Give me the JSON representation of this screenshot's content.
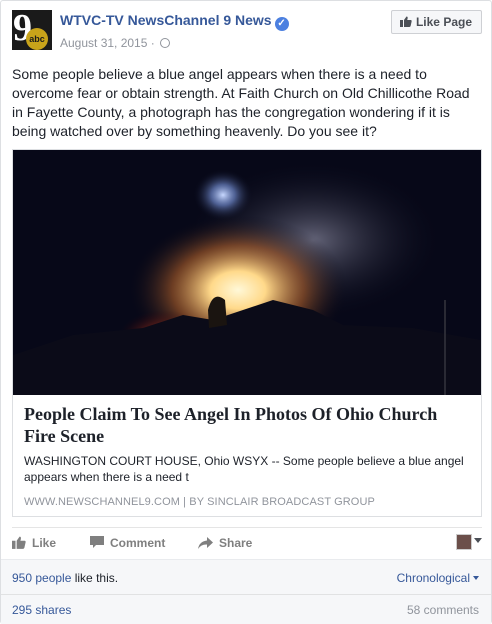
{
  "header": {
    "page_name": "WTVC-TV NewsChannel 9 News",
    "date": "August 31, 2015 ·",
    "like_page_label": "Like Page",
    "avatar_text": "9",
    "avatar_badge": "abc"
  },
  "post": {
    "text": "Some people believe a blue angel appears when there is a need to overcome fear or obtain strength. At Faith Church on Old Chillicothe Road in Fayette County, a photograph has the congregation wondering if it is being watched over by something heavenly. Do you see it?"
  },
  "link_card": {
    "title": "People Claim To See Angel In Photos Of Ohio Church Fire Scene",
    "description": "WASHINGTON COURT HOUSE, Ohio WSYX -- Some people believe a blue angel appears when there is a need t",
    "source": "WWW.NEWSCHANNEL9.COM  |  BY SINCLAIR BROADCAST GROUP"
  },
  "actions": {
    "like": "Like",
    "comment": "Comment",
    "share": "Share"
  },
  "ufi": {
    "likes_count": "950 people",
    "likes_suffix": " like this.",
    "sort_label": "Chronological",
    "shares": "295 shares",
    "comments": "58 comments"
  },
  "colors": {
    "link_blue": "#365899",
    "verified_blue": "#4c80e0",
    "muted_gray": "#90949c"
  },
  "icons": [
    "verified-badge-icon",
    "globe-icon",
    "thumbs-up-icon",
    "comment-icon",
    "share-icon",
    "caret-down-icon"
  ]
}
